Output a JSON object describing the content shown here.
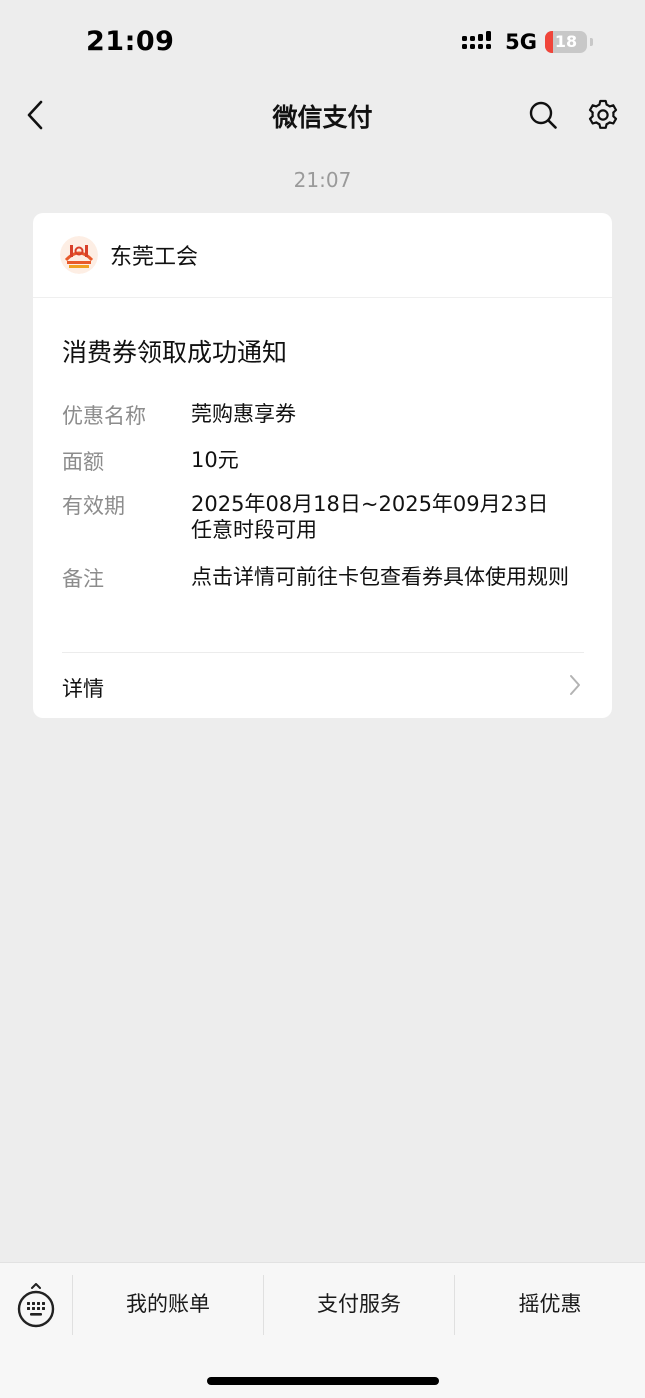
{
  "status_bar": {
    "time": "21:09",
    "network": "5G",
    "battery_percent": 18,
    "battery_label": "18",
    "battery_color": "#f0453a",
    "icons": [
      "signal-icon",
      "battery-icon"
    ]
  },
  "nav": {
    "title": "微信支付",
    "icons": [
      "back-arrow-icon",
      "search-icon",
      "gear-icon"
    ]
  },
  "message": {
    "timestamp": "21:07",
    "org_name": "东莞工会",
    "logo_icon": "org-logo-icon",
    "title": "消费券领取成功通知",
    "fields": [
      {
        "label": "优惠名称",
        "value": "莞购惠享券"
      },
      {
        "label": "面额",
        "value": "10元"
      },
      {
        "label": "有效期",
        "value_line1": "2025年08月18日~2025年09月23日",
        "value_line2": "任意时段可用"
      },
      {
        "label": "备注",
        "value": "点击详情可前往卡包查看券具体使用规则"
      }
    ],
    "details_label": "详情",
    "details_icon": "chevron-right-icon"
  },
  "bottom_bar": {
    "keyboard_icon": "keyboard-icon",
    "items": [
      {
        "label": "我的账单"
      },
      {
        "label": "支付服务"
      },
      {
        "label": "摇优惠"
      }
    ]
  },
  "colors": {
    "background": "#ededed",
    "card": "#ffffff",
    "label_gray": "#8c8c8c",
    "timestamp_gray": "#9a9a9a"
  }
}
